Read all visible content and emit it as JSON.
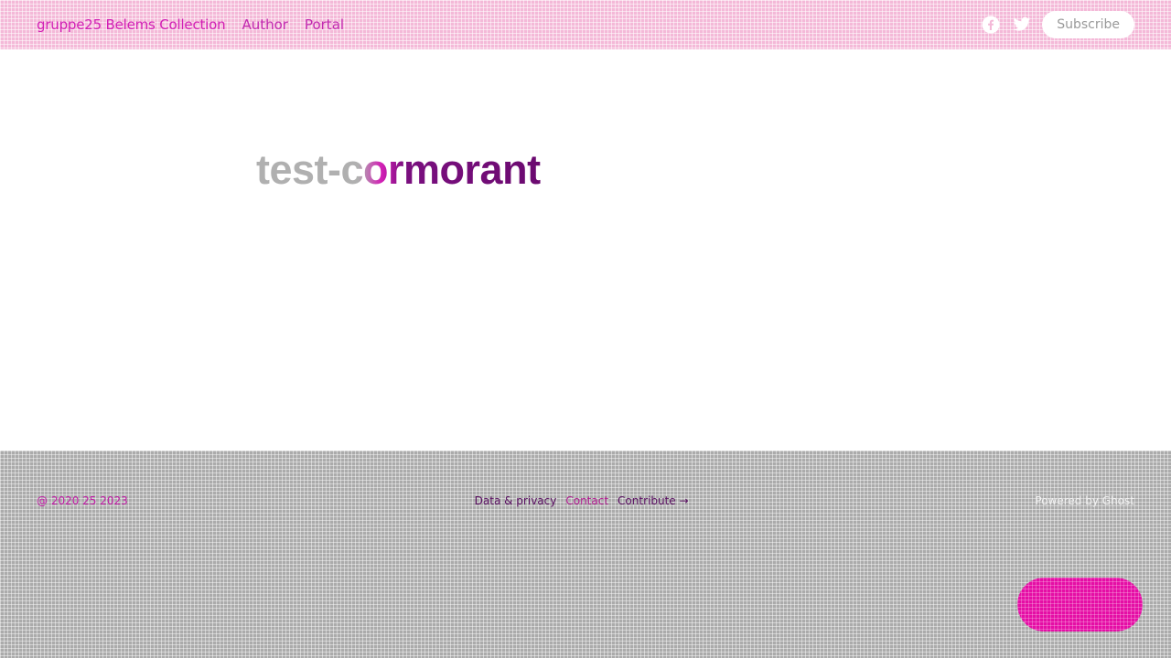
{
  "header": {
    "site_title": "gruppe25 Belems Collection",
    "nav": [
      {
        "label": "Author"
      },
      {
        "label": "Portal"
      }
    ],
    "social_icons": [
      "facebook-icon",
      "twitter-icon"
    ],
    "subscribe_label": "Subscribe"
  },
  "main": {
    "post_title": "test-cormorant"
  },
  "footer": {
    "copyright": "@ 2020 25 2023",
    "nav": [
      {
        "label": "Data & privacy"
      },
      {
        "label": "Contact"
      },
      {
        "label": "Contribute →"
      }
    ],
    "powered_by": "Powered by Ghost"
  },
  "colors": {
    "header_bg": "#f4b9d8",
    "accent": "#d21fb5",
    "footer_bg": "#ababab",
    "portal_button": "#e50ea5"
  }
}
